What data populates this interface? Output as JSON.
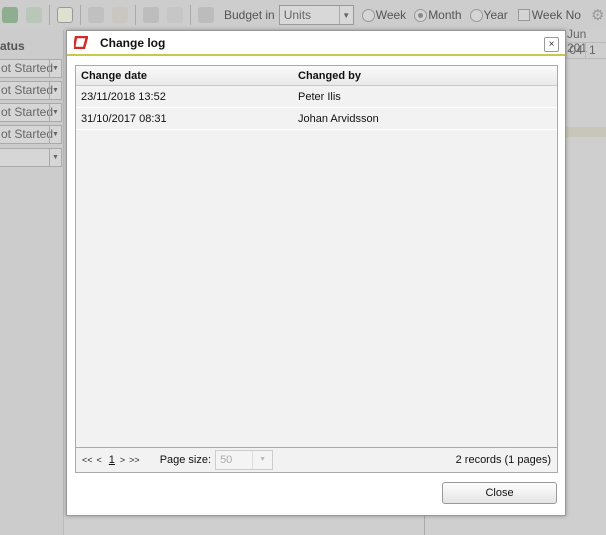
{
  "toolbar": {
    "budget_label": "Budget in",
    "budget_value": "Units",
    "options": [
      {
        "label": "Week",
        "checked": false
      },
      {
        "label": "Month",
        "checked": true
      },
      {
        "label": "Year",
        "checked": false
      }
    ],
    "week_no_label": "Week No"
  },
  "left_panel": {
    "header": "atus",
    "dropdowns": [
      "ot Started",
      "ot Started",
      "ot Started",
      "ot Started",
      ""
    ]
  },
  "right_panel": {
    "month": "Jun 201",
    "days": [
      "04",
      "1"
    ]
  },
  "dialog": {
    "title": "Change log",
    "close_symbol": "×",
    "columns": [
      "Change date",
      "Changed by"
    ],
    "rows": [
      [
        "23/11/2018 13:52",
        "Peter Ilis"
      ],
      [
        "31/10/2017 08:31",
        "Johan Arvidsson"
      ]
    ],
    "pager": {
      "first": "<<",
      "prev": "<",
      "page": "1",
      "next": ">",
      "last": ">>",
      "page_size_label": "Page size:",
      "page_size": "50",
      "records": "2 records (1 pages)"
    },
    "close_button": "Close"
  },
  "colors": {
    "accent": "#c8c84a",
    "logo": "#d22a2a"
  }
}
